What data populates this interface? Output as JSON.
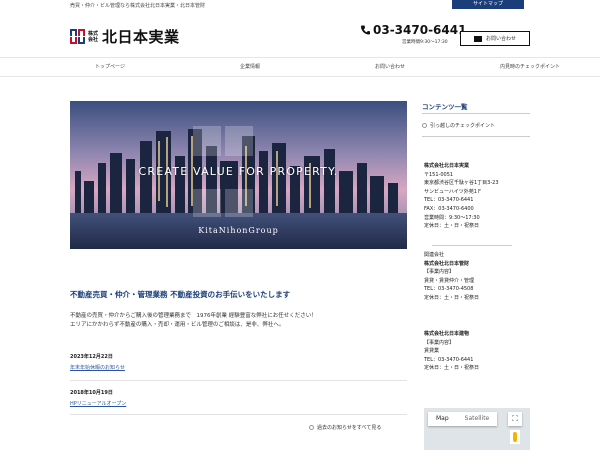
{
  "header": {
    "tagline": "売買・仲介・ビル管理なら株式会社北日本実業・北日本管財",
    "sitemap_label": "サイトマップ",
    "logo_kabushiki": "株式会社",
    "logo_name": "北日本実業",
    "phone": "03-3470-6441",
    "hours": "営業時間9:30～17:30",
    "contact_label": "お問い合わせ"
  },
  "nav": {
    "items": [
      {
        "label": "トップページ"
      },
      {
        "label": "企業情報"
      },
      {
        "label": "お問い合わせ"
      },
      {
        "label": "内見時のチェックポイント"
      }
    ]
  },
  "hero": {
    "title": "CREATE VALUE FOR PROPERTY.",
    "group_name": "KitaNihonGroup"
  },
  "main": {
    "heading": "不動産売買・仲介・管理業務 不動産投資のお手伝いをいたします",
    "desc": [
      "不動産の売買・仲介からご購入後の管理業務まで　1976年創業 経験豊富な弊社にお任せください！",
      "エリアにかかわらず不動産の購入・売却・運用・ビル管理のご相談は、是非、弊社へ。"
    ],
    "news": [
      {
        "date": "2023年12月22日",
        "title": "年末年始休暇のお知らせ"
      },
      {
        "date": "2018年10月19日",
        "title": "HPリニューアルオープン"
      }
    ],
    "all_news_label": "過去のお知らせをすべて見る"
  },
  "sidebar": {
    "heading": "コンテンツ一覧",
    "link": "引っ越しのチェックポイント",
    "company1": {
      "name": "株式会社北日本実業",
      "lines": [
        "〒151-0051",
        "東京都渋谷区千駄ヶ谷1丁目3-23",
        "サンビューハイツ外苑1Ｆ",
        "TEL：03-3470-6441",
        "FAX：03-3470-6400",
        "営業時間：9:30～17:30",
        "定休日：土・日・祝祭日"
      ]
    },
    "company2": {
      "pre": "関連会社",
      "name": "株式会社北日本管財",
      "lines": [
        "【事業内容】",
        "賃貸・賃貸仲介・管理",
        "TEL：03-3470-4508",
        "定休日：土・日・祝祭日"
      ]
    },
    "company3": {
      "name": "株式会社北日本建物",
      "lines": [
        "【事業内容】",
        "賃貸業",
        "TEL：03-3470-6441",
        "定休日：土・日・祝祭日"
      ]
    },
    "map": {
      "tab_map": "Map",
      "tab_satellite": "Satellite"
    }
  },
  "colors": {
    "accent": "#1b3e7a",
    "link": "#2a55a3"
  }
}
